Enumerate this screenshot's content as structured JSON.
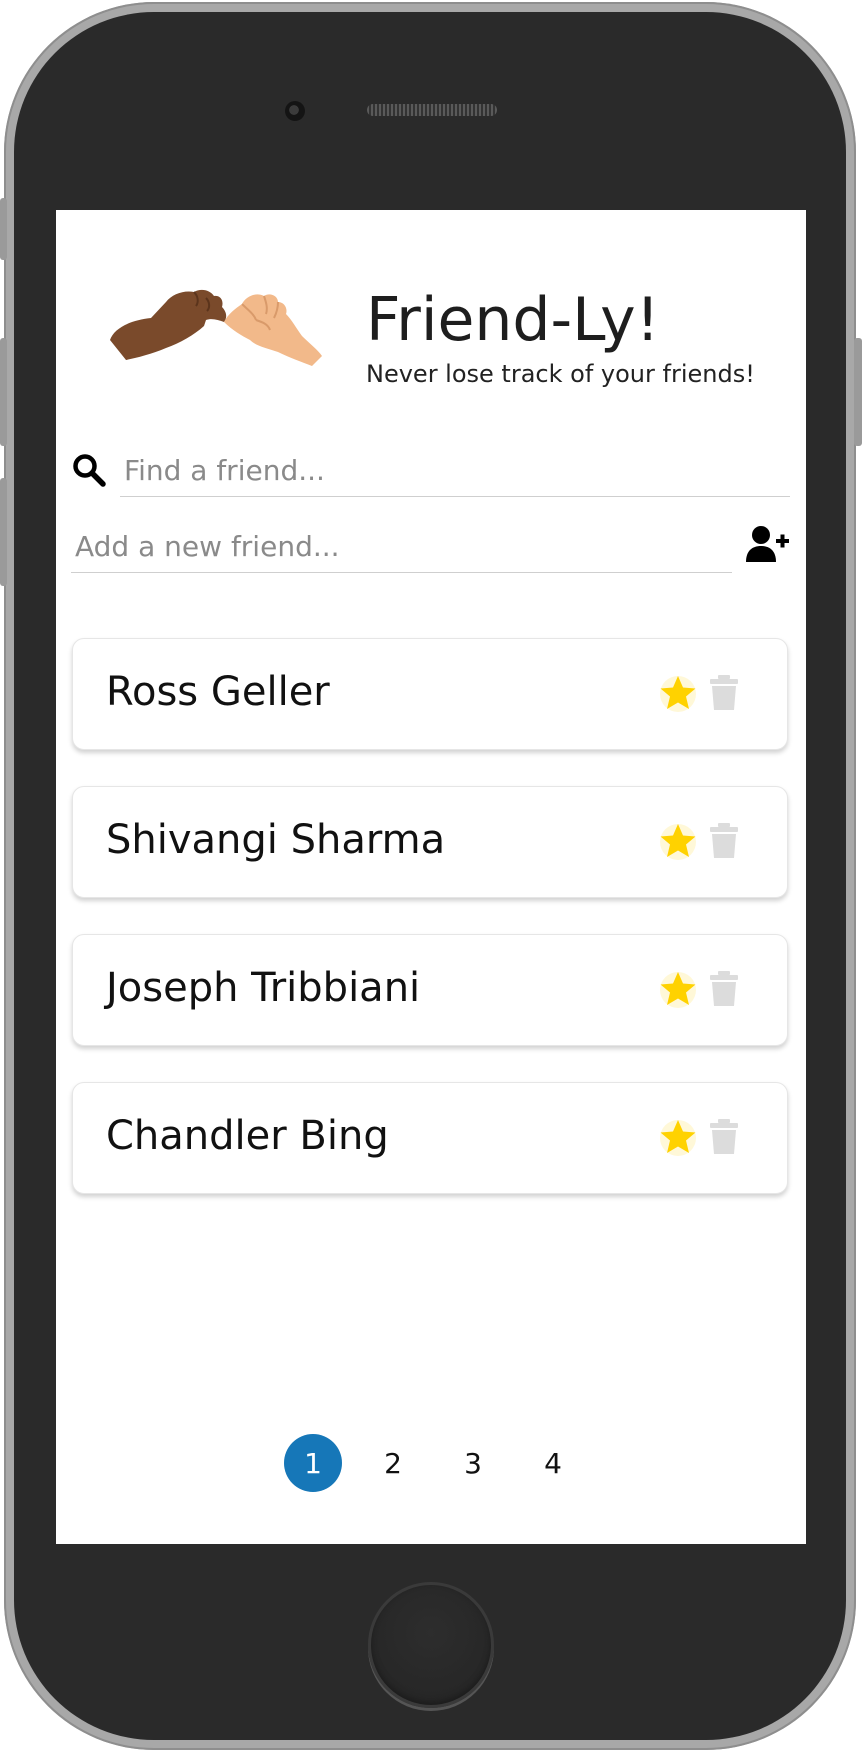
{
  "app": {
    "title": "Friend-Ly!",
    "tagline": "Never lose track of your friends!"
  },
  "search": {
    "placeholder": "Find a friend...",
    "value": ""
  },
  "add_friend": {
    "placeholder": "Add a new friend...",
    "value": ""
  },
  "friends": [
    {
      "name": "Ross Geller",
      "favorite": true
    },
    {
      "name": "Shivangi Sharma",
      "favorite": true
    },
    {
      "name": "Joseph Tribbiani",
      "favorite": true
    },
    {
      "name": "Chandler Bing",
      "favorite": true
    }
  ],
  "pagination": {
    "pages": [
      "1",
      "2",
      "3",
      "4"
    ],
    "current": "1"
  },
  "icons": {
    "logo": "pinky-promise-hands-logo",
    "search": "search-icon",
    "add_user": "add-user-icon",
    "favorite": "star-icon",
    "delete": "trash-icon"
  },
  "colors": {
    "accent": "#1677b8",
    "star": "#ffd200",
    "trash": "#dcdcdc",
    "text": "#111111"
  }
}
